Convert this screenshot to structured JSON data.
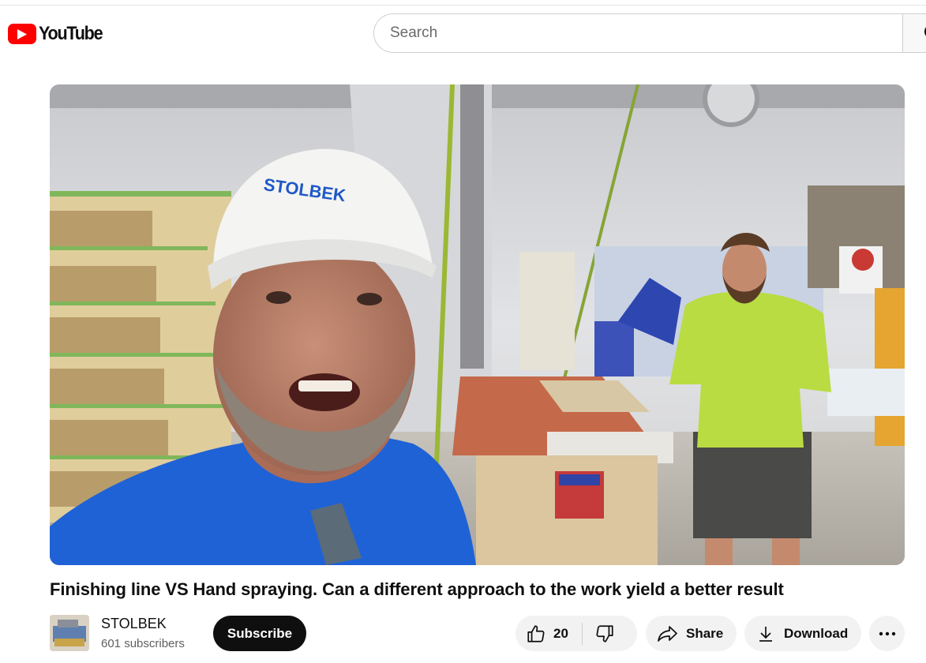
{
  "header": {
    "logo_text": "YouTube",
    "search_placeholder": "Search"
  },
  "video": {
    "title": "Finishing line VS Hand spraying. Can a different approach to the work yield a better result",
    "cap_text": "STOLBEK"
  },
  "channel": {
    "name": "STOLBEK",
    "subscribers": "601 subscribers",
    "subscribe_label": "Subscribe"
  },
  "actions": {
    "like_count": "20",
    "share_label": "Share",
    "download_label": "Download"
  },
  "icons": {
    "logo": "youtube-play-icon",
    "search": "search-icon",
    "like": "thumbs-up-icon",
    "dislike": "thumbs-down-icon",
    "share": "share-arrow-icon",
    "download": "download-icon",
    "more": "more-horizontal-icon"
  },
  "colors": {
    "brand_red": "#ff0000",
    "subscribe_bg": "#0f0f0f",
    "pill_bg": "#f2f2f2"
  }
}
